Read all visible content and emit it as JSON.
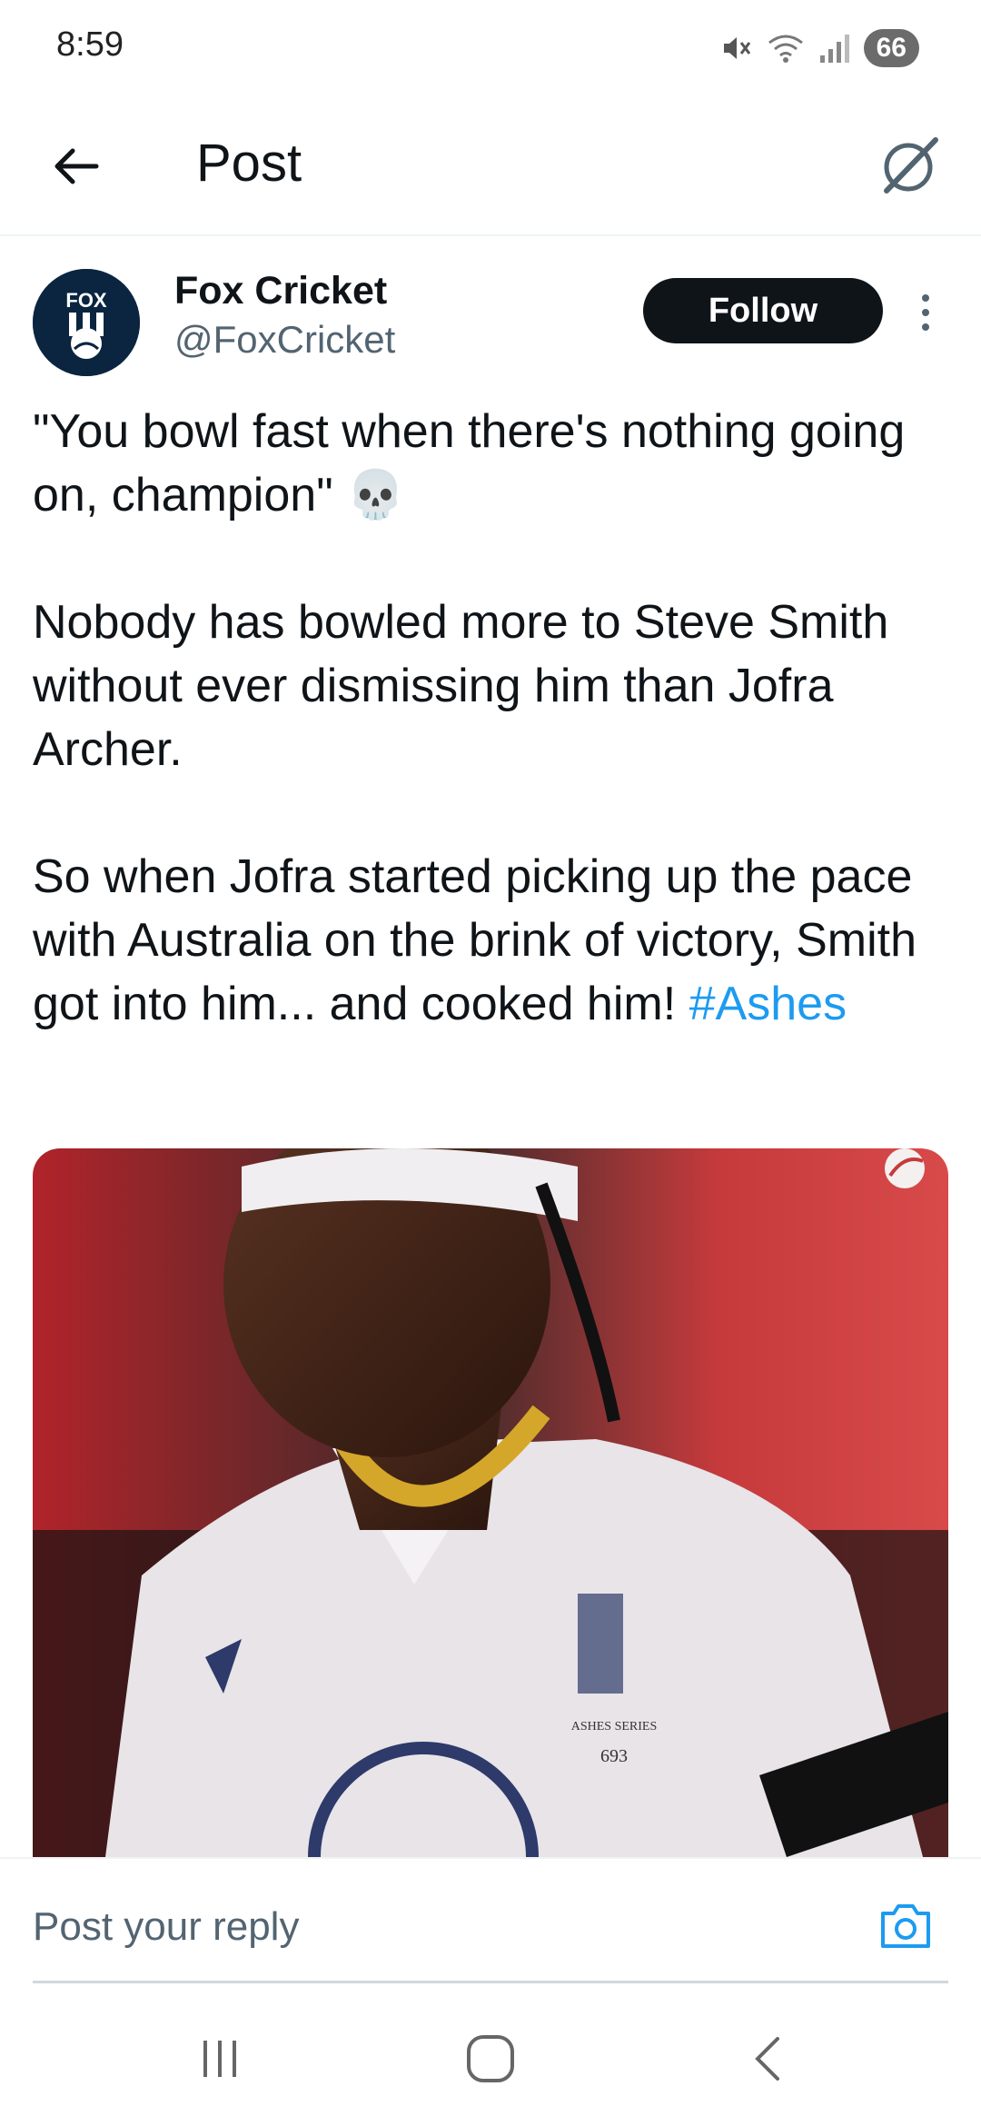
{
  "status_bar": {
    "time": "8:59",
    "battery": "66",
    "icons": [
      "mute-icon",
      "wifi-icon",
      "signal-icon",
      "battery-icon"
    ]
  },
  "header": {
    "title": "Post",
    "back_icon": "back-arrow-icon",
    "grok_icon": "grok-icon"
  },
  "post": {
    "author_name": "Fox Cricket",
    "author_handle": "@FoxCricket",
    "avatar_label": "FOX",
    "follow_label": "Follow",
    "text_line1": "\"You bowl fast when there's nothing going on, champion\" 💀",
    "text_para2": "Nobody has bowled more to Steve Smith without ever dismissing him than Jofra Archer.",
    "text_para3": "So when Jofra started picking up the pace with Australia on the brink of victory, Smith got into him... and cooked him! ",
    "hashtag": "#Ashes",
    "media_description": "Video still of cricket player",
    "shirt_text": "ASHES SERIES",
    "shirt_number": "693"
  },
  "reply": {
    "placeholder": "Post your reply",
    "camera_icon": "camera-icon"
  },
  "nav": {
    "recent_icon": "recent-apps-icon",
    "home_icon": "home-icon",
    "back_icon": "nav-back-icon"
  },
  "colors": {
    "accent": "#1d9bf0",
    "text": "#0f1419",
    "secondary": "#536471",
    "follow_bg": "#0f1419"
  }
}
